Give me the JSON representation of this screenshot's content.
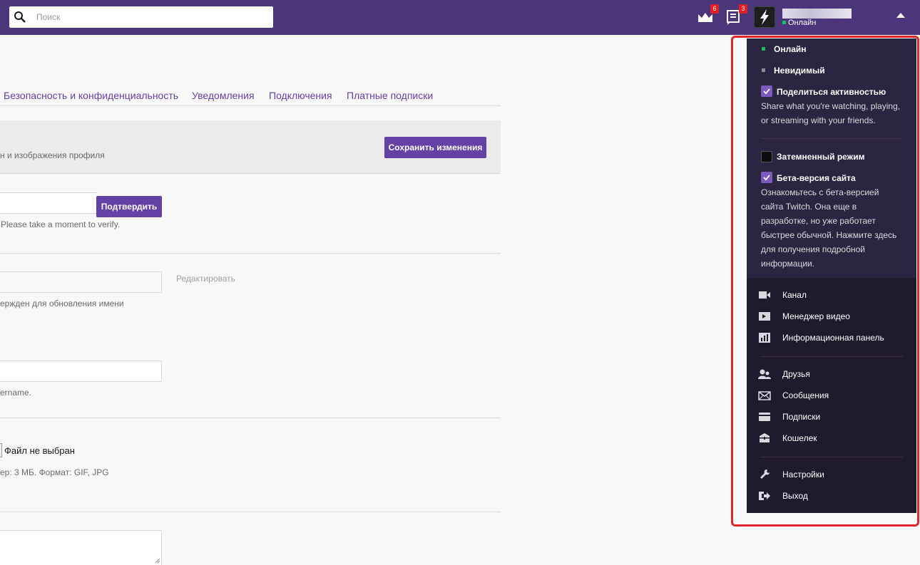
{
  "topnav": {
    "search_placeholder": "Поиск",
    "prime_badge": "6",
    "notifications_badge": "3",
    "user_status": "Онлайн"
  },
  "tabs": [
    "Безопасность и конфиденциальность",
    "Уведомления",
    "Подключения",
    "Платные подписки"
  ],
  "profile": {
    "section_subtitle": "н и изображения профиля",
    "save_label": "Сохранить изменения",
    "verify_label": "Подтвердить",
    "verify_hint": "Please take a moment to verify.",
    "edit_label": "Редактировать",
    "name_hint": "ержден для обновления имени",
    "username_hint": "ername.",
    "file_status": "Файл не выбран",
    "file_hint": "ер: 3 МБ. Формат: GIF, JPG"
  },
  "dropdown": {
    "status_online": "Онлайн",
    "status_invisible": "Невидимый",
    "share_activity_label": "Поделиться активностью",
    "share_activity_desc": "Share what you're watching, playing, or streaming with your friends.",
    "dark_mode_label": "Затемненный режим",
    "beta_label": "Бета-версия сайта",
    "beta_desc": "Ознакомьтесь с бета-версией сайта Twitch. Она еще в разработке, но уже работает быстрее обычной.    Нажмите здесь для получения подробной информации.",
    "menu": {
      "channel": "Канал",
      "video_manager": "Менеджер видео",
      "dashboard": "Информационная панель",
      "friends": "Друзья",
      "messages": "Сообщения",
      "subscriptions": "Подписки",
      "wallet": "Кошелек",
      "settings": "Настройки",
      "logout": "Выход"
    }
  },
  "colors": {
    "brand": "#6441a4",
    "nav_bg": "#4b367c",
    "dropdown_bg": "#2c2541",
    "online": "#1dbd5c",
    "highlight_frame": "#e0262c"
  }
}
